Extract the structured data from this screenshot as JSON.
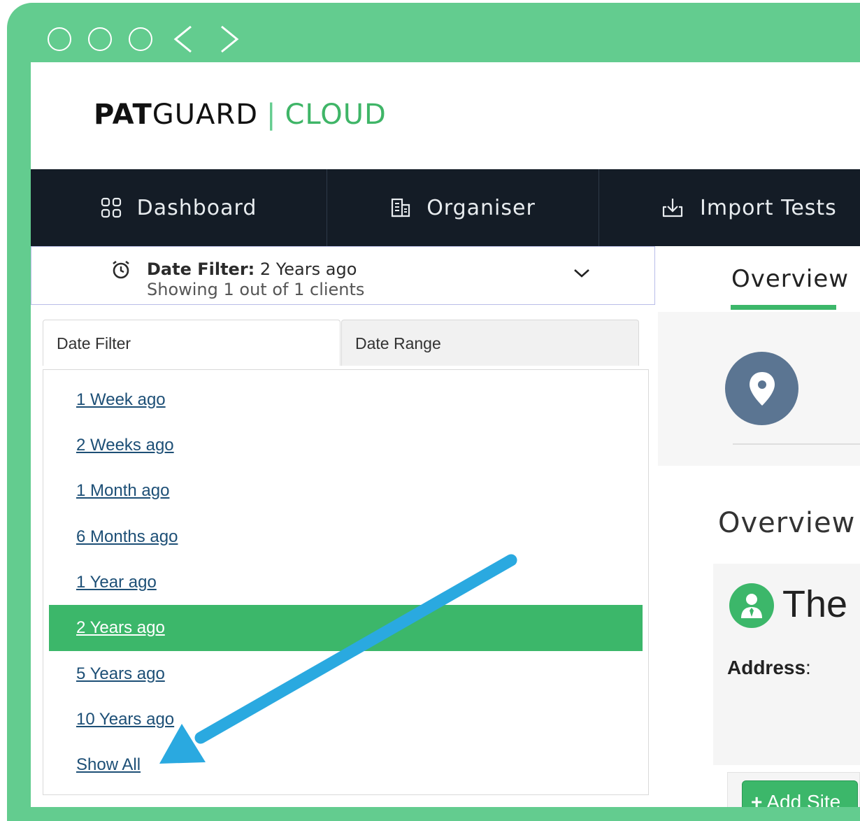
{
  "browser": {
    "back_icon": "chevron-left-icon",
    "forward_icon": "chevron-right-icon"
  },
  "logo": {
    "part1": "PAT",
    "part2": "GUARD",
    "separator": "|",
    "part3": "CLOUD"
  },
  "nav": {
    "items": [
      {
        "label": "Dashboard",
        "icon": "grid-icon"
      },
      {
        "label": "Organiser",
        "icon": "building-icon"
      },
      {
        "label": "Import Tests",
        "icon": "download-icon"
      }
    ]
  },
  "filter_bar": {
    "label": "Date Filter:",
    "value": "2 Years ago",
    "summary": "Showing 1 out of 1 clients"
  },
  "filter_tabs": [
    {
      "label": "Date Filter",
      "active": true
    },
    {
      "label": "Date Range",
      "active": false
    }
  ],
  "date_options": [
    {
      "label": "1 Week ago"
    },
    {
      "label": "2 Weeks ago"
    },
    {
      "label": "1 Month ago"
    },
    {
      "label": "6 Months ago"
    },
    {
      "label": "1 Year ago"
    },
    {
      "label": "2 Years ago",
      "selected": true
    },
    {
      "label": "5 Years ago"
    },
    {
      "label": "10 Years ago"
    },
    {
      "label": "Show All"
    }
  ],
  "right_panel": {
    "tab_label": "Overview",
    "heading": "Overview",
    "card_title": "The",
    "address_label": "Address",
    "add_site_button": "Add Site"
  },
  "colors": {
    "frame": "#63cc8f",
    "navbar": "#141c26",
    "accent_green": "#3cb76a",
    "link": "#1d4f76",
    "annotation_arrow": "#2aa9e0"
  }
}
